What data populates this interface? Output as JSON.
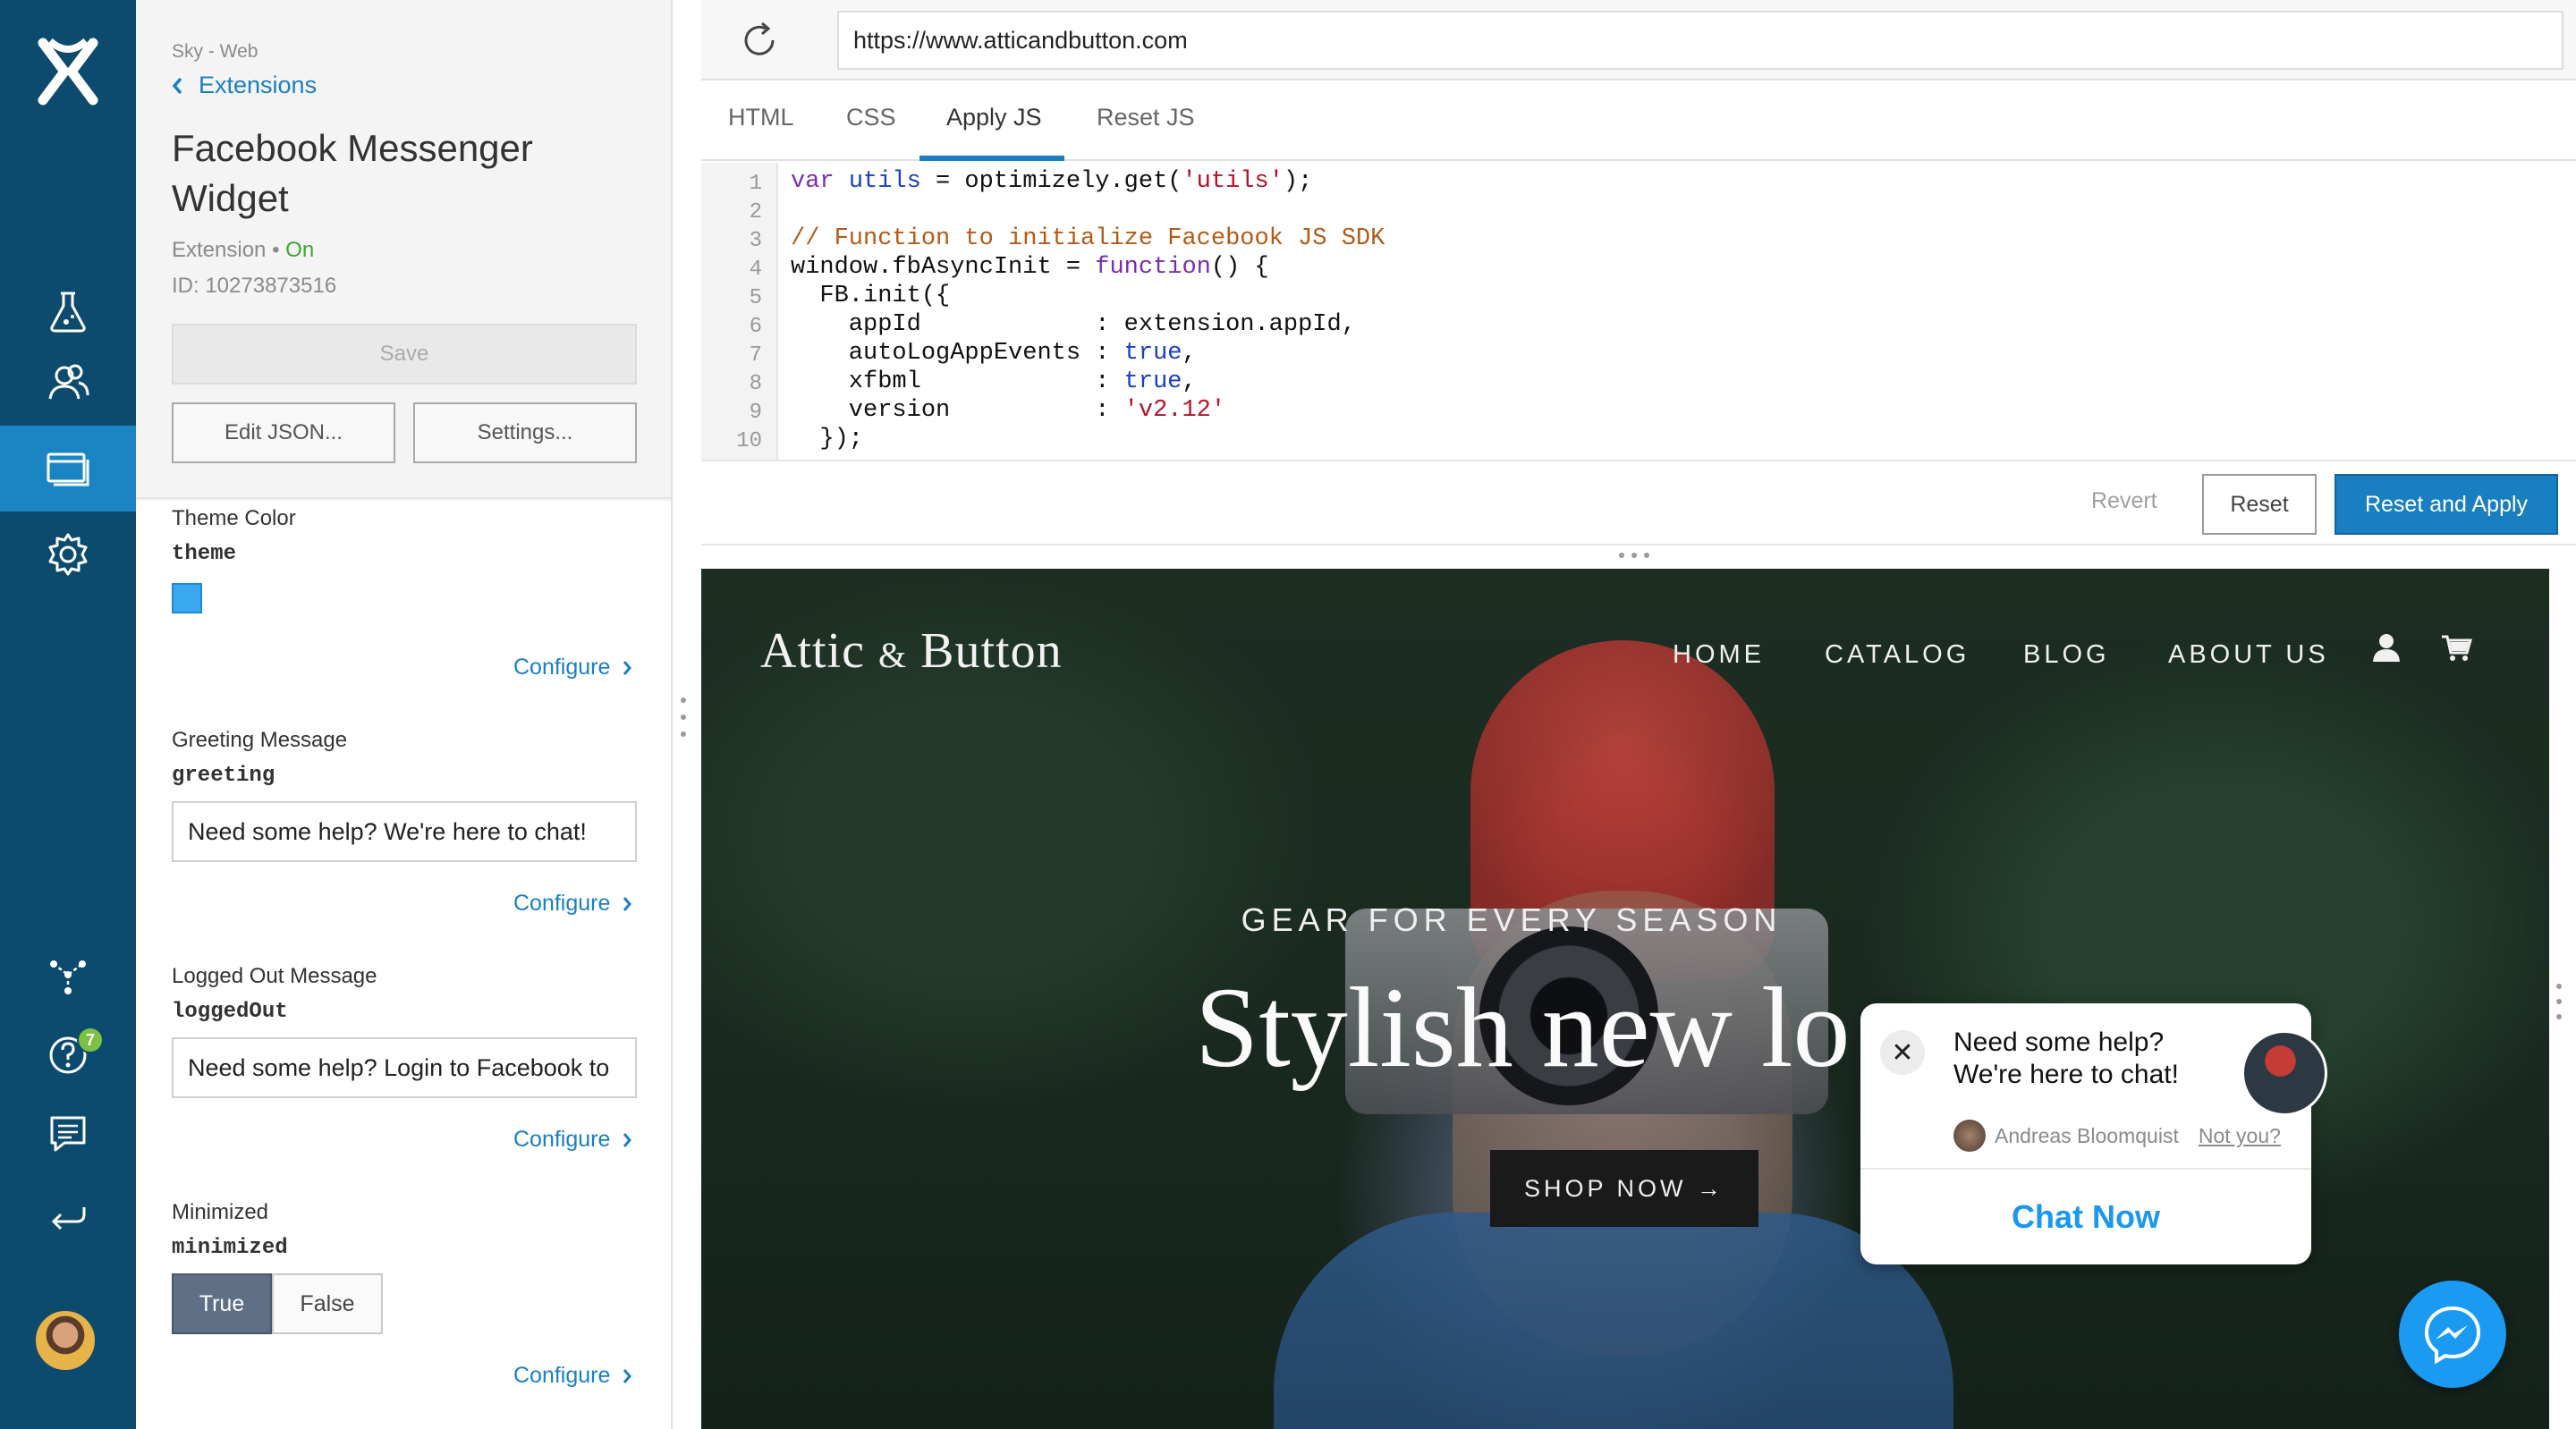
{
  "app": {
    "logo_icon": "optimizely-x-logo",
    "colors": {
      "rail": "#0d4b6e",
      "rail_active": "#1b85c3",
      "accent": "#1a7fc1",
      "on": "#3fa535",
      "messenger": "#1a9af0"
    }
  },
  "rail": {
    "items": [
      {
        "icon": "flask-icon"
      },
      {
        "icon": "audiences-icon"
      },
      {
        "icon": "extensions-icon",
        "active": true
      },
      {
        "icon": "settings-gear-icon"
      },
      {
        "icon": "program-nodes-icon"
      },
      {
        "icon": "help-icon"
      },
      {
        "icon": "feedback-icon"
      },
      {
        "icon": "return-icon"
      }
    ],
    "help_badge": "7"
  },
  "panel": {
    "breadcrumb": "Sky - Web",
    "back_label": "Extensions",
    "title": "Facebook Messenger Widget",
    "meta_prefix": "Extension",
    "meta_sep": "•",
    "status": "On",
    "id_text": "ID: 10273873516",
    "save_label": "Save",
    "edit_json_label": "Edit JSON...",
    "settings_label": "Settings...",
    "fields": [
      {
        "label": "Theme Color",
        "key": "theme",
        "type": "color",
        "color": "#3aa8f0",
        "configure": "Configure"
      },
      {
        "label": "Greeting Message",
        "key": "greeting",
        "type": "text",
        "value": "Need some help? We're here to chat!",
        "configure": "Configure"
      },
      {
        "label": "Logged Out Message",
        "key": "loggedOut",
        "type": "text",
        "value": "Need some help? Login to Facebook to",
        "configure": "Configure"
      },
      {
        "label": "Minimized",
        "key": "minimized",
        "type": "toggle",
        "options": [
          "True",
          "False"
        ],
        "selected": "True",
        "configure": "Configure"
      }
    ]
  },
  "browser": {
    "url": "https://www.atticandbutton.com",
    "tabs": [
      {
        "label": "HTML"
      },
      {
        "label": "CSS"
      },
      {
        "label": "Apply JS",
        "active": true
      },
      {
        "label": "Reset JS"
      }
    ]
  },
  "editor": {
    "line_numbers": [
      "1",
      "2",
      "3",
      "4",
      "5",
      "6",
      "7",
      "8",
      "9",
      "10"
    ],
    "lines": [
      "var utils = optimizely.get('utils');",
      "",
      "// Function to initialize Facebook JS SDK",
      "window.fbAsyncInit = function() {",
      "  FB.init({",
      "    appId            : extension.appId,",
      "    autoLogAppEvents : true,",
      "    xfbml            : true,",
      "    version          : 'v2.12'",
      "  });"
    ]
  },
  "actions": {
    "revert_label": "Revert",
    "reset_label": "Reset",
    "reset_apply_label": "Reset and Apply"
  },
  "site": {
    "logo_main": "Attic",
    "logo_amp": "&",
    "logo_end": "Button",
    "nav": [
      "HOME",
      "CATALOG",
      "BLOG",
      "ABOUT US"
    ],
    "nav_icons": [
      "user-icon",
      "cart-icon"
    ],
    "hero_subtitle": "GEAR FOR EVERY SEASON",
    "hero_title": "Stylish new lo",
    "shop_label": "SHOP NOW →"
  },
  "chat": {
    "message": "Need some help? We're here to chat!",
    "user_name": "Andreas Bloomquist",
    "not_you": "Not you?",
    "chat_now": "Chat Now",
    "close_glyph": "✕"
  }
}
